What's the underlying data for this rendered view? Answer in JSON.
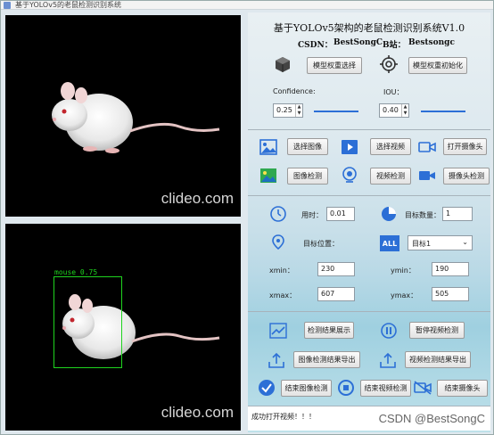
{
  "window": {
    "title": "基于YOLOv5的老鼠检测识别系统"
  },
  "images": {
    "top_watermark": "clideo.com",
    "bottom_watermark": "clideo.com"
  },
  "detection": {
    "label": "mouse 0.75"
  },
  "header": {
    "title": "基于YOLOv5架构的老鼠检测识别系统V1.0",
    "csdn_label": "CSDN：",
    "csdn_value": "BestSongC",
    "bili_label": "B站：",
    "bili_value": "Bestsongc"
  },
  "model": {
    "select_weights": "模型权重选择",
    "init_weights": "模型权重初始化"
  },
  "params": {
    "confidence_label": "Confidence:",
    "confidence_value": "0.25",
    "confidence_level": 0.25,
    "iou_label": "IOU：",
    "iou_value": "0.40",
    "iou_level": 0.4
  },
  "input": {
    "select_image": "选择图像",
    "select_video": "选择视频",
    "open_camera": "打开摄像头",
    "detect_image": "图像检测",
    "detect_video": "视频检测",
    "detect_camera": "摄像头检测"
  },
  "results": {
    "time_label": "用时：",
    "time_value": "0.01",
    "count_label": "目标数量：",
    "count_value": "1",
    "position_label": "目标位置：",
    "target_select": "目标1",
    "xmin_label": "xmin：",
    "xmin_value": "230",
    "ymin_label": "ymin：",
    "ymin_value": "190",
    "xmax_label": "xmax：",
    "xmax_value": "607",
    "ymax_label": "ymax：",
    "ymax_value": "505"
  },
  "actions": {
    "show_results": "检测结果展示",
    "pause_video": "暂停视频检测",
    "export_image": "图像检测结果导出",
    "export_video": "视频检测结果导出",
    "stop_image": "结束图像检测",
    "stop_video": "结束视频检测",
    "stop_camera": "结束摄像头"
  },
  "status": {
    "message": "成功打开视频！！！"
  },
  "footer": {
    "watermark": "CSDN @BestSongC"
  },
  "colors": {
    "accent": "#2c6fd6",
    "detect_box": "#1fd41f"
  }
}
